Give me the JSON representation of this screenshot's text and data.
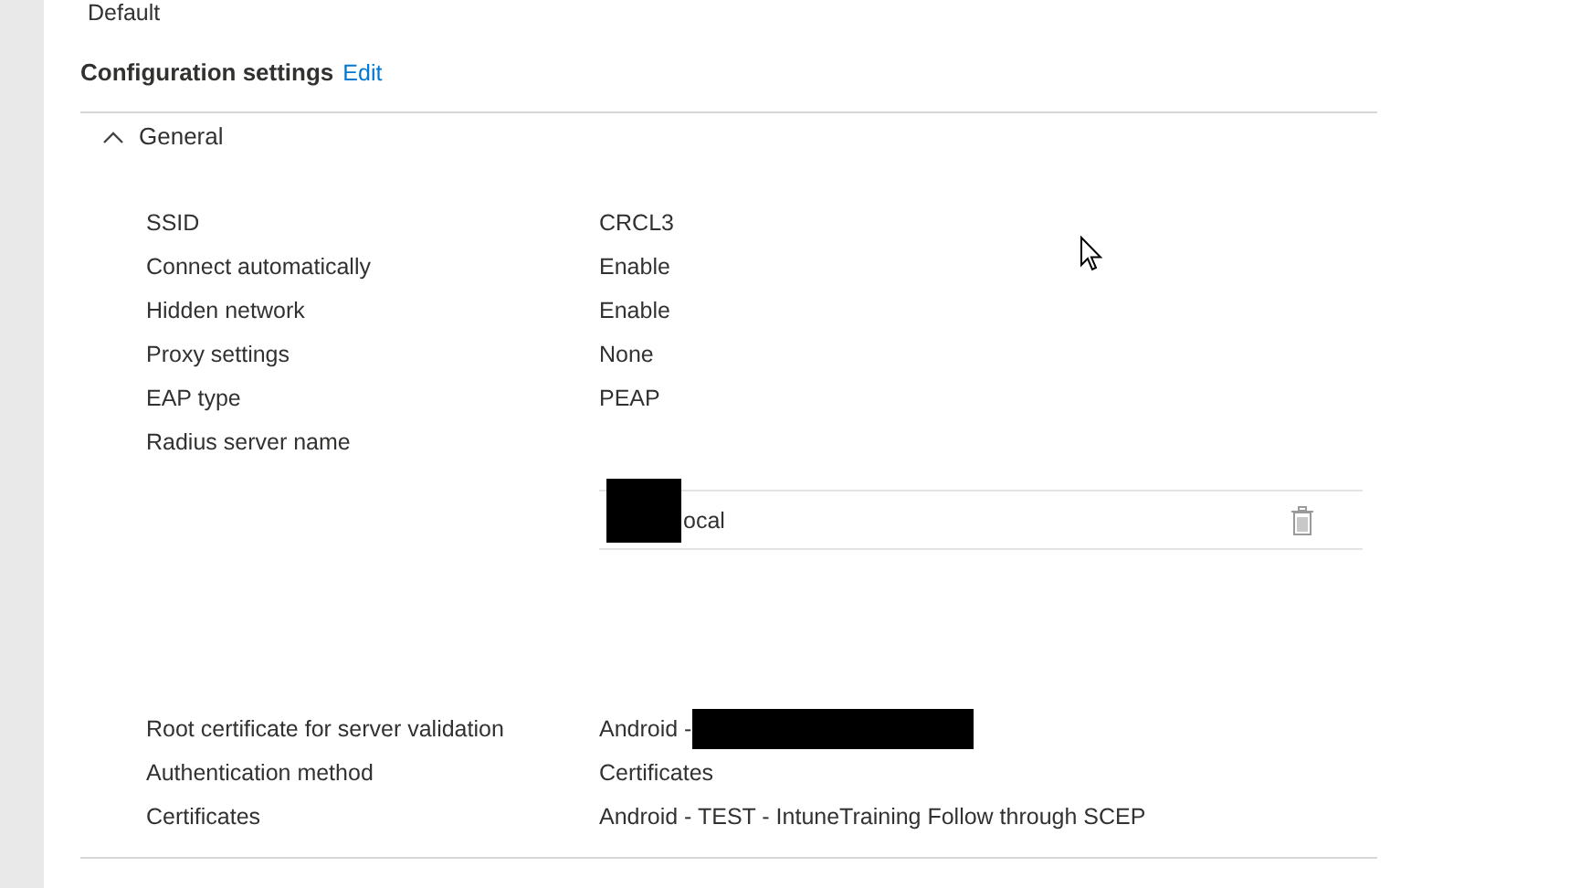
{
  "header": {
    "default_value": "Default"
  },
  "section": {
    "title": "Configuration settings",
    "edit_link": "Edit"
  },
  "group": {
    "title": "General",
    "expanded": true
  },
  "settings": [
    {
      "kind": "text",
      "label": "SSID",
      "value": "CRCL3"
    },
    {
      "kind": "text",
      "label": "Connect automatically",
      "value": "Enable"
    },
    {
      "kind": "text",
      "label": "Hidden network",
      "value": "Enable"
    },
    {
      "kind": "text",
      "label": "Proxy settings",
      "value": "None"
    },
    {
      "kind": "text",
      "label": "EAP type",
      "value": "PEAP"
    },
    {
      "kind": "list",
      "label": "Radius server name",
      "items": [
        {
          "value": "ocal",
          "redacted": true
        }
      ]
    },
    {
      "kind": "text",
      "label": "Root certificate for server validation",
      "value": "Android -",
      "redacted": true
    },
    {
      "kind": "text",
      "label": "Authentication method",
      "value": "Certificates"
    },
    {
      "kind": "text",
      "label": "Certificates",
      "value": "Android - TEST - IntuneTraining Follow through SCEP"
    }
  ]
}
